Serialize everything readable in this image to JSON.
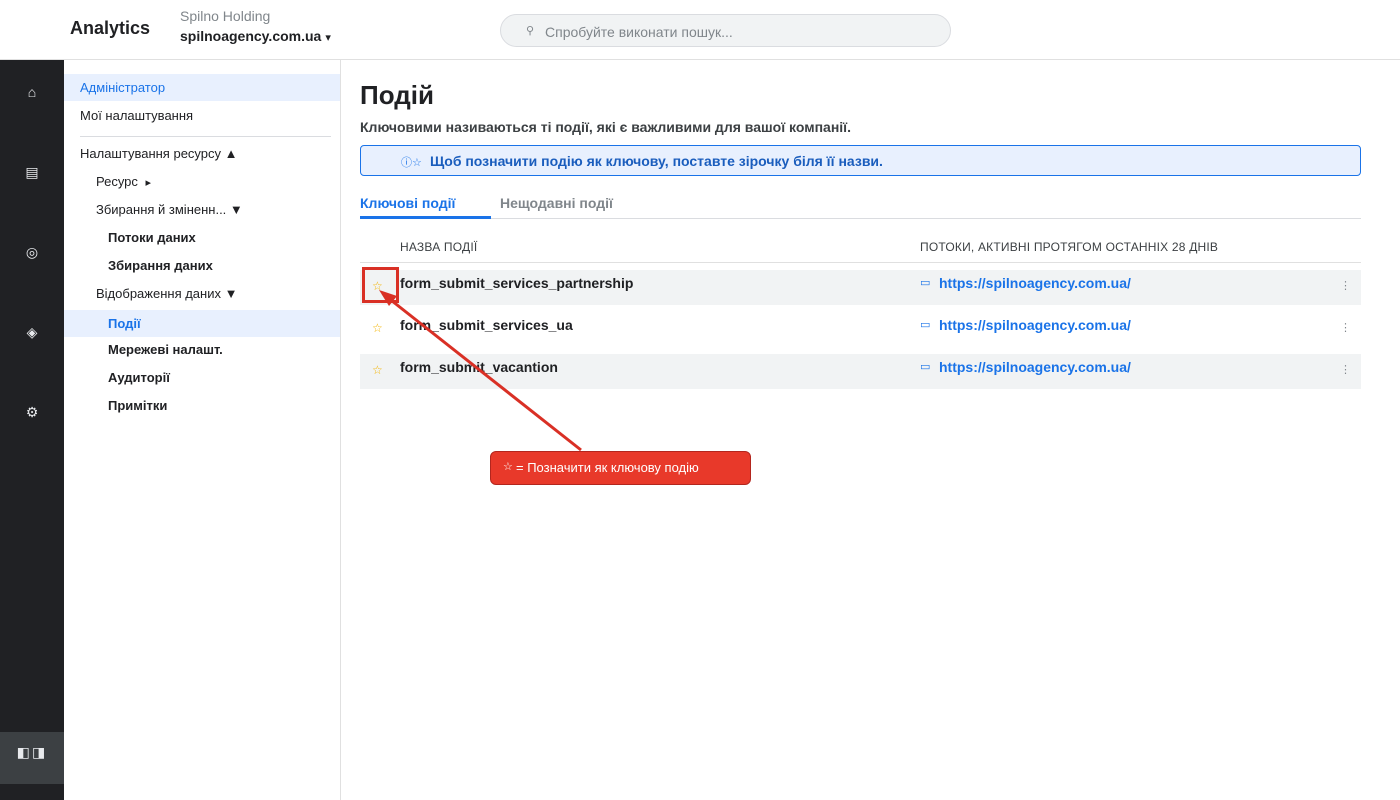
{
  "header": {
    "app_title": "Analytics",
    "account": "Spilno Holding",
    "property": "spilnoagency.com.ua",
    "property_icon": "chevron-down-icon",
    "search_placeholder": "Спробуйте виконати пошук...",
    "search_icon": "search-icon"
  },
  "rail": {
    "icons": [
      "home-icon",
      "reports-icon",
      "explore-icon",
      "advertising-icon",
      "admin-icon"
    ],
    "bottom_icon": "collapse-icon"
  },
  "sidenav": {
    "admin": "Адміністратор",
    "my_settings": "Мої налаштування",
    "property_settings": "Налаштування ресурсу ▲",
    "resource": "Ресурс",
    "collection": "Збирання й зміненн... ▼",
    "data_streams": "Потоки даних",
    "data_collection": "Збирання даних",
    "data_display": "Відображення даних ▼",
    "events": "Події",
    "network_settings": "Мережеві налашт.",
    "audiences": "Аудиторії",
    "notes": "Примітки"
  },
  "main": {
    "title": "Подій",
    "subtitle": "Ключовими називаються ті події, які є важливими для вашої компанії.",
    "info_icon": "info-icon",
    "info": "Щоб позначити подію як ключову, поставте зірочку біля її назви.",
    "tabs": [
      "Ключові події",
      "Нещодавні події"
    ],
    "columns": [
      "НАЗВА ПОДІЇ",
      "ПОТОКИ, АКТИВНІ ПРОТЯГОМ ОСТАННІХ 28 ДНІВ"
    ],
    "rows": [
      {
        "name": "form_submit_services_partnership",
        "stream": "https://spilnoagency.com.ua/"
      },
      {
        "name": "form_submit_services_ua",
        "stream": "https://spilnoagency.com.ua/"
      },
      {
        "name": "form_submit_vacantion",
        "stream": "https://spilnoagency.com.ua/"
      }
    ],
    "callout": "= Позначити як ключову подію"
  },
  "colors": {
    "accent": "#1a73e8",
    "star": "#f4b400",
    "annotation": "#e8392a",
    "rail": "#202124"
  }
}
